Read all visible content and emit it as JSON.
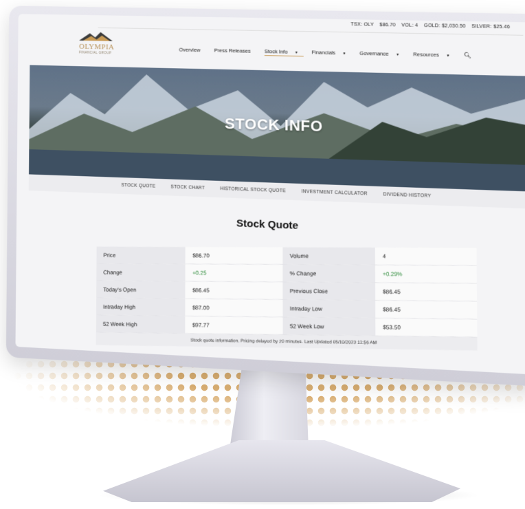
{
  "ticker": {
    "symbol": "TSX: OLY",
    "price": "$86.70",
    "volume": "VOL: 4",
    "gold": "GOLD: $2,030.50",
    "silver": "SILVER: $25.46"
  },
  "logo": {
    "name": "OLYMPIA",
    "sub": "FINANCIAL GROUP"
  },
  "nav": {
    "items": [
      {
        "label": "Overview"
      },
      {
        "label": "Press Releases"
      },
      {
        "label": "Stock Info",
        "active": true,
        "dropdown": true
      },
      {
        "label": "Financials",
        "dropdown": true
      },
      {
        "label": "Governance",
        "dropdown": true
      },
      {
        "label": "Resources",
        "dropdown": true
      }
    ]
  },
  "hero": {
    "title": "STOCK INFO"
  },
  "subnav": {
    "items": [
      "STOCK QUOTE",
      "STOCK CHART",
      "HISTORICAL STOCK QUOTE",
      "INVESTMENT CALCULATOR",
      "DIVIDEND HISTORY"
    ]
  },
  "quote": {
    "title": "Stock Quote",
    "rows": [
      {
        "l1": "Price",
        "v1": "$86.70",
        "l2": "Volume",
        "v2": "4"
      },
      {
        "l1": "Change",
        "v1": "+0.25",
        "l2": "% Change",
        "v2": "+0.29%"
      },
      {
        "l1": "Today's Open",
        "v1": "$86.45",
        "l2": "Previous Close",
        "v2": "$86.45"
      },
      {
        "l1": "Intraday High",
        "v1": "$87.00",
        "l2": "Intraday Low",
        "v2": "$86.45"
      },
      {
        "l1": "52 Week High",
        "v1": "$97.77",
        "l2": "52 Week Low",
        "v2": "$53.50"
      }
    ],
    "footnote": "Stock quote information. Pricing delayed by 20 minutes. Last Updated 05/10/2023 11:56 AM"
  },
  "colors": {
    "accent": "#c89a55",
    "positive": "#2e8b3a"
  }
}
